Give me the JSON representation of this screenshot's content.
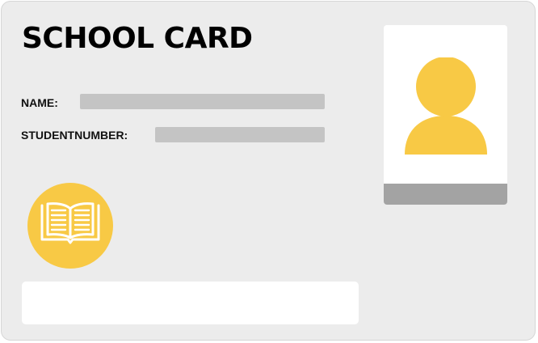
{
  "card": {
    "title": "SCHOOL CARD",
    "background_color": "#ececec",
    "accent_color": "#f8c945"
  },
  "fields": {
    "name_label": "NAME:",
    "name_value": "",
    "student_number_label": "STUDENTNUMBER:",
    "student_number_value": ""
  },
  "photo": {
    "icon": "person-avatar-icon",
    "strip_color": "#a3a3a3"
  },
  "badge": {
    "icon": "open-book-icon"
  },
  "footer": {
    "text": ""
  }
}
